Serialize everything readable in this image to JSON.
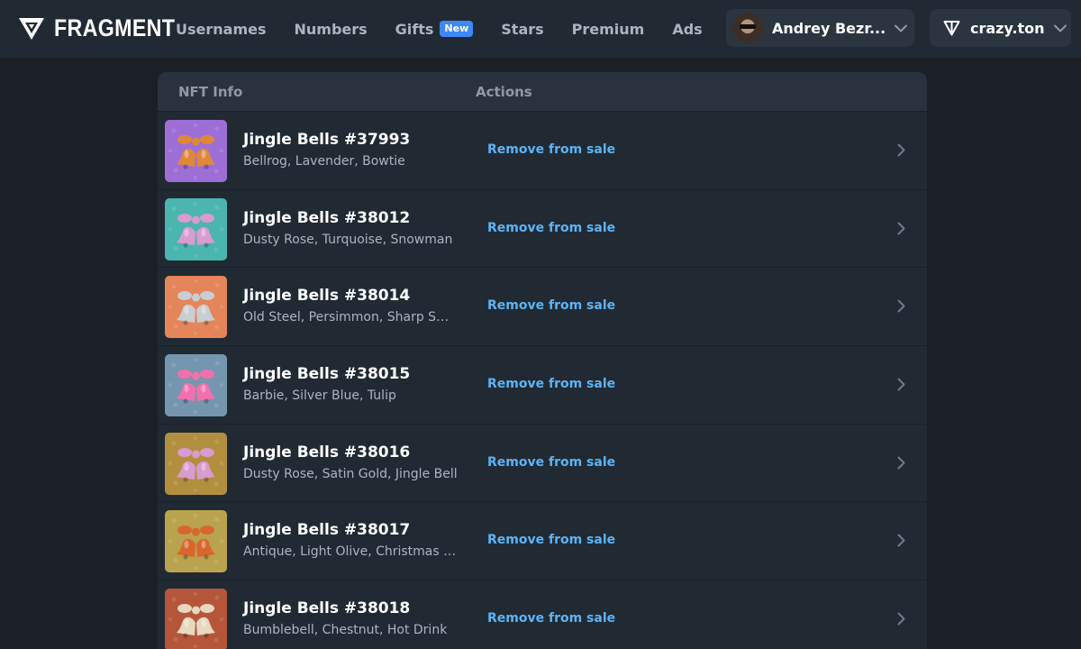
{
  "header": {
    "logo_text": "FRAGMENT",
    "nav": [
      {
        "label": "Usernames"
      },
      {
        "label": "Numbers"
      },
      {
        "label": "Gifts",
        "badge": "New"
      },
      {
        "label": "Stars"
      },
      {
        "label": "Premium"
      },
      {
        "label": "Ads"
      }
    ],
    "user": {
      "name": "Andrey Bezr..."
    },
    "wallet": {
      "name": "crazy.ton"
    }
  },
  "table": {
    "columns": {
      "info": "NFT Info",
      "actions": "Actions"
    },
    "rows": [
      {
        "title": "Jingle Bells #37993",
        "attrs": "Bellrog, Lavender, Bowtie",
        "action": "Remove from sale",
        "bg": "#9d6fd6",
        "bell": "#e0883a"
      },
      {
        "title": "Jingle Bells #38012",
        "attrs": "Dusty Rose, Turquoise, Snowman",
        "action": "Remove from sale",
        "bg": "#4bb5b0",
        "bell": "#d99bd0"
      },
      {
        "title": "Jingle Bells #38014",
        "attrs": "Old Steel, Persimmon, Sharp Sword",
        "action": "Remove from sale",
        "bg": "#e5855a",
        "bell": "#c9ced3"
      },
      {
        "title": "Jingle Bells #38015",
        "attrs": "Barbie, Silver Blue, Tulip",
        "action": "Remove from sale",
        "bg": "#7596ae",
        "bell": "#f26fae"
      },
      {
        "title": "Jingle Bells #38016",
        "attrs": "Dusty Rose, Satin Gold, Jingle Bell",
        "action": "Remove from sale",
        "bg": "#b28f3f",
        "bell": "#d99bd0"
      },
      {
        "title": "Jingle Bells #38017",
        "attrs": "Antique, Light Olive, Christmas Tr...",
        "action": "Remove from sale",
        "bg": "#b9a34e",
        "bell": "#d9662e"
      },
      {
        "title": "Jingle Bells #38018",
        "attrs": "Bumblebell, Chestnut, Hot Drink",
        "action": "Remove from sale",
        "bg": "#b5563a",
        "bell": "#e8d8c0"
      }
    ]
  }
}
